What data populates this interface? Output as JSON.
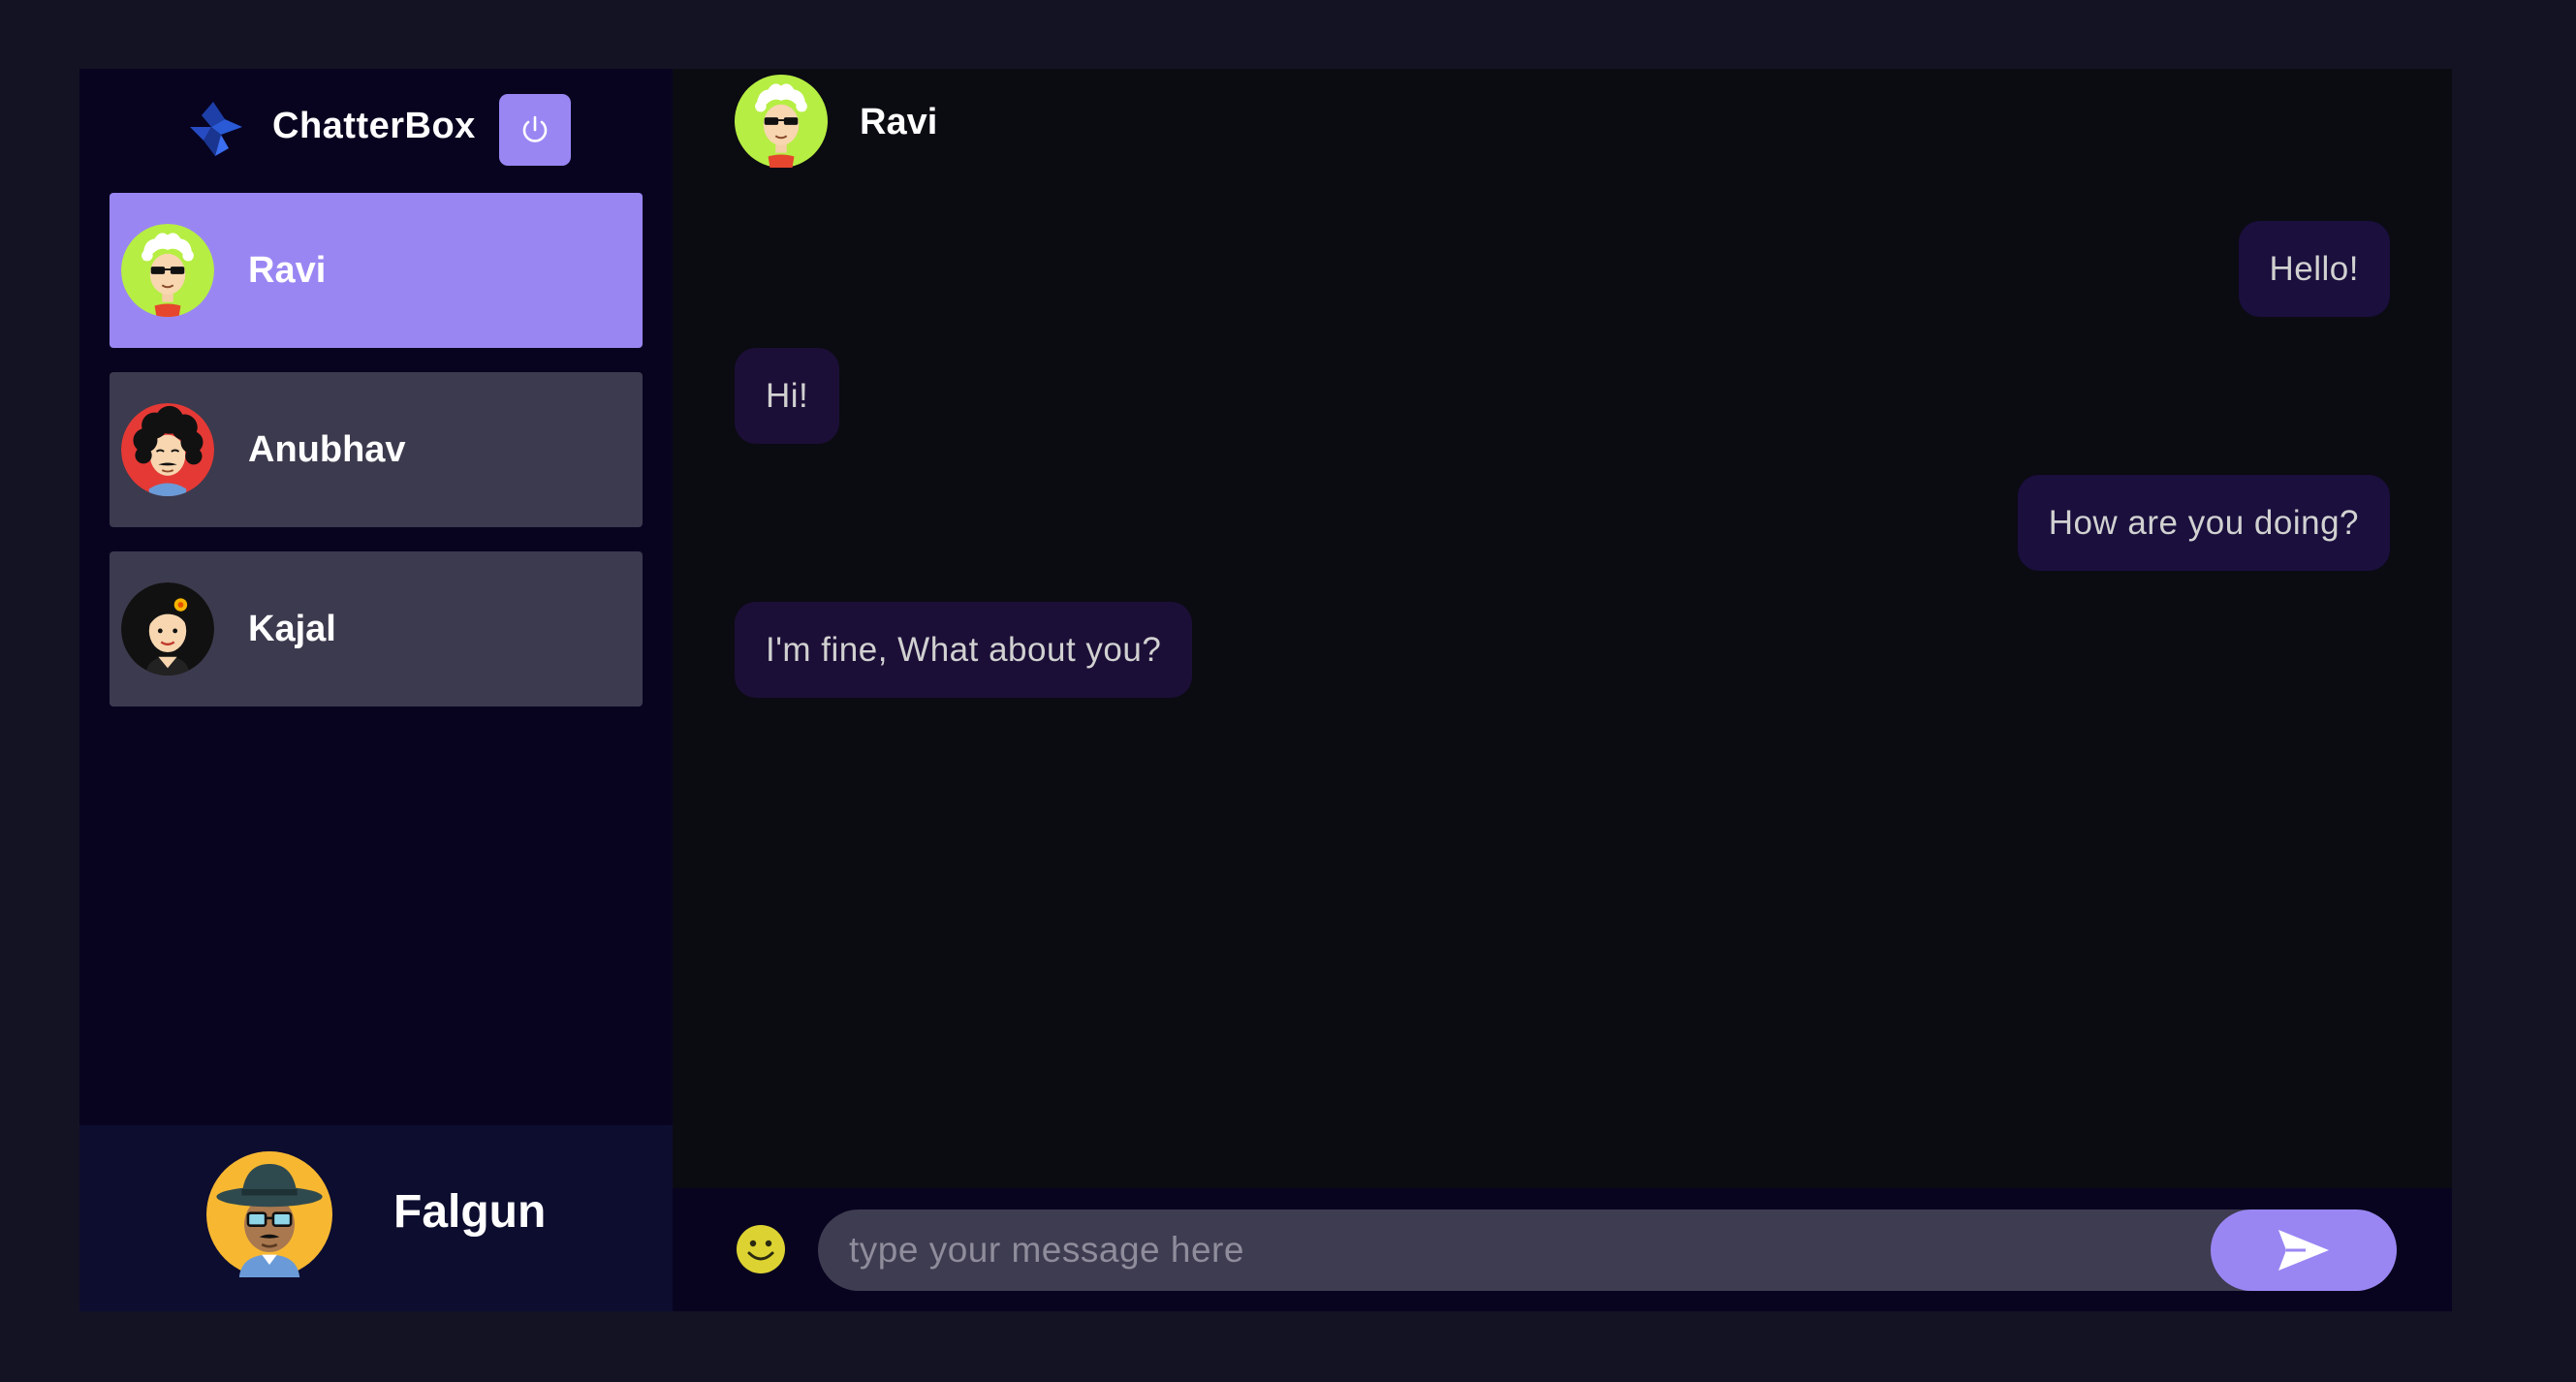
{
  "brand": {
    "name": "ChatterBox",
    "logo_icon": "diamond-logo-icon",
    "accent": "#9a86f3"
  },
  "toolbar": {
    "logout_icon": "power-icon"
  },
  "contacts": [
    {
      "name": "Ravi",
      "selected": true,
      "avatar": "avatar-white-hair-sunglasses"
    },
    {
      "name": "Anubhav",
      "selected": false,
      "avatar": "avatar-curly-hair-mustache"
    },
    {
      "name": "Kajal",
      "selected": false,
      "avatar": "avatar-woman-flower"
    }
  ],
  "current_user": {
    "name": "Falgun",
    "avatar": "avatar-hat-glasses"
  },
  "chat": {
    "header_name": "Ravi",
    "messages": [
      {
        "text": "Hello!",
        "direction": "sent"
      },
      {
        "text": "Hi!",
        "direction": "received"
      },
      {
        "text": "How are you doing?",
        "direction": "sent"
      },
      {
        "text": "I'm fine, What about you?",
        "direction": "received"
      }
    ]
  },
  "composer": {
    "placeholder": "type your message here",
    "value": "",
    "emoji_icon": "smiley-icon",
    "send_icon": "send-icon"
  },
  "colors": {
    "page_background": "#131324",
    "sidebar_background": "#080420",
    "contact_background": "#3c3a4e",
    "selected_contact_background": "#9a86f3",
    "bubble_background": "#1a0f3d"
  }
}
